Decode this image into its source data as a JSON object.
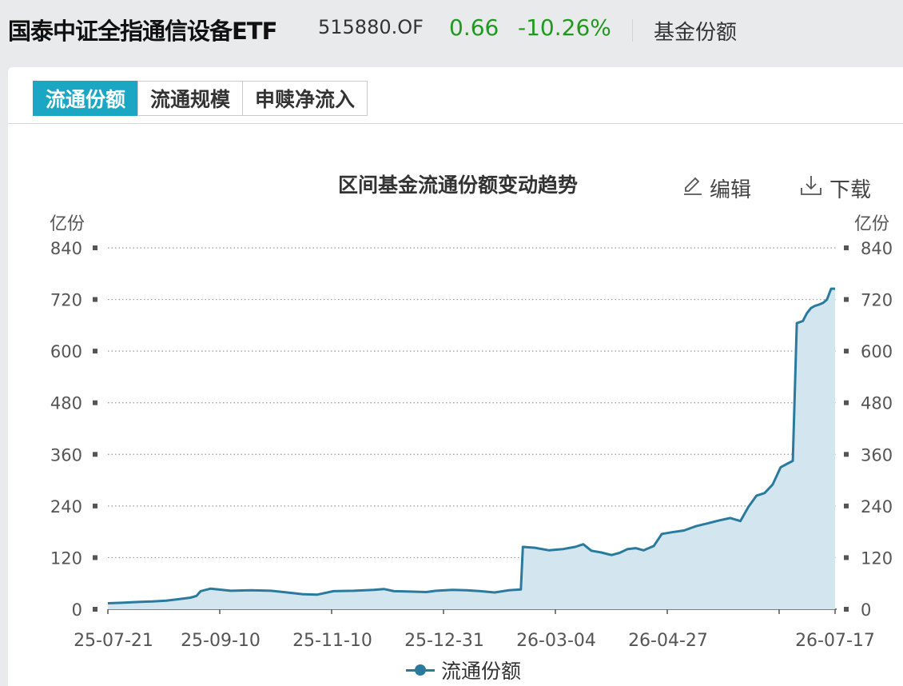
{
  "header": {
    "fund_name": "国泰中证全指通信设备ETF",
    "fund_code": "515880.OF",
    "price": "0.66",
    "change_pct": "-10.26%",
    "share_link": "基金份额"
  },
  "tabs": [
    {
      "label": "流通份额",
      "active": true
    },
    {
      "label": "流通规模",
      "active": false
    },
    {
      "label": "申赎净流入",
      "active": false
    }
  ],
  "toolbar": {
    "edit_label": "编辑",
    "download_label": "下载"
  },
  "chart_data": {
    "type": "area",
    "title": "区间基金流通份额变动趋势",
    "ylabel_left": "亿份",
    "ylabel_right": "亿份",
    "ylim": [
      0,
      840
    ],
    "yticks": [
      0,
      120,
      240,
      360,
      480,
      600,
      720,
      840
    ],
    "xlim": [
      "2025-07-21",
      "2026-07-17"
    ],
    "xticks": [
      "25-07-21",
      "25-09-10",
      "25-11-10",
      "25-12-31",
      "26-03-04",
      "26-04-27",
      "26-07-17"
    ],
    "grid": true,
    "legend_position": "bottom",
    "colors": {
      "line": "#2a7a9e",
      "fill": "#d3e6ef",
      "grid": "#999999"
    },
    "series": [
      {
        "name": "流通份额",
        "x": [
          "2025-07-21",
          "2025-07-28",
          "2025-08-05",
          "2025-08-12",
          "2025-08-19",
          "2025-08-26",
          "2025-08-31",
          "2025-09-03",
          "2025-09-05",
          "2025-09-10",
          "2025-09-20",
          "2025-09-30",
          "2025-10-10",
          "2025-10-18",
          "2025-10-26",
          "2025-11-02",
          "2025-11-10",
          "2025-11-20",
          "2025-11-30",
          "2025-12-05",
          "2025-12-10",
          "2025-12-18",
          "2025-12-26",
          "2025-12-31",
          "2026-01-08",
          "2026-01-15",
          "2026-01-22",
          "2026-01-29",
          "2026-02-05",
          "2026-02-11",
          "2026-02-12",
          "2026-02-18",
          "2026-02-25",
          "2026-03-04",
          "2026-03-10",
          "2026-03-14",
          "2026-03-18",
          "2026-03-23",
          "2026-03-28",
          "2026-04-01",
          "2026-04-05",
          "2026-04-09",
          "2026-04-13",
          "2026-04-18",
          "2026-04-22",
          "2026-04-27",
          "2026-05-03",
          "2026-05-09",
          "2026-05-15",
          "2026-05-20",
          "2026-05-26",
          "2026-05-31",
          "2026-06-04",
          "2026-06-08",
          "2026-06-12",
          "2026-06-16",
          "2026-06-20",
          "2026-06-24",
          "2026-06-26",
          "2026-06-28",
          "2026-07-01",
          "2026-07-03",
          "2026-07-05",
          "2026-07-07",
          "2026-07-09",
          "2026-07-11",
          "2026-07-13",
          "2026-07-15",
          "2026-07-17"
        ],
        "values": [
          14,
          15,
          17,
          18,
          20,
          24,
          27,
          31,
          42,
          48,
          43,
          44,
          43,
          39,
          35,
          34,
          42,
          43,
          45,
          47,
          42,
          41,
          40,
          43,
          45,
          44,
          42,
          39,
          44,
          46,
          145,
          143,
          137,
          140,
          145,
          151,
          136,
          132,
          126,
          131,
          140,
          142,
          137,
          147,
          175,
          179,
          183,
          193,
          200,
          206,
          212,
          205,
          238,
          264,
          270,
          290,
          330,
          340,
          345,
          665,
          670,
          688,
          700,
          705,
          708,
          712,
          720,
          745,
          745
        ]
      }
    ]
  },
  "legend": {
    "label": "流通份额"
  }
}
